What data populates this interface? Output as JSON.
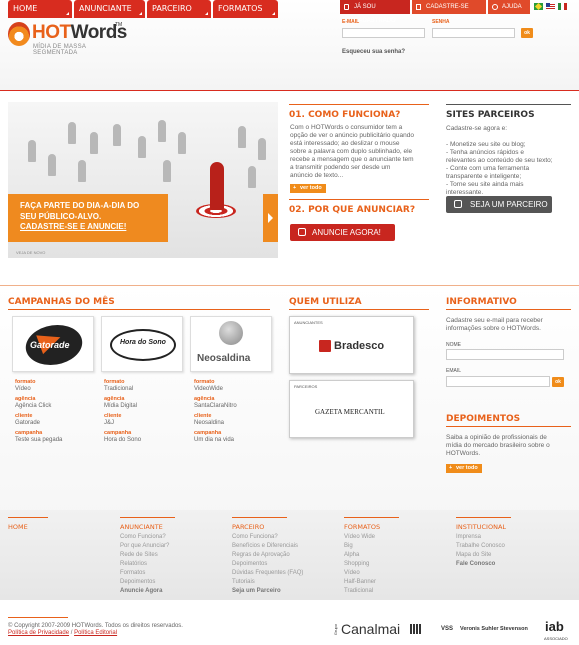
{
  "header": {
    "logo_text_hot": "HOT",
    "logo_text_words": "Words",
    "logo_tm": "TM",
    "logo_sub": "MÍDIA DE MASSA SEGMENTADA",
    "top_tabs": [
      "JÁ SOU CADASTRADO",
      "CADASTRE-SE",
      "AJUDA"
    ],
    "email_label": "E-MAIL",
    "password_label": "SENHA",
    "ok_label": "ok",
    "forgot": "Esqueceu sua senha?",
    "nav": [
      "HOME",
      "ANUNCIANTE",
      "PARCEIRO",
      "FORMATOS"
    ]
  },
  "hero": {
    "banner_line1": "FAÇA PARTE DO DIA-A-DIA DO",
    "banner_line2": "SEU PÚBLICO-ALVO.",
    "banner_link": "CADASTRE-SE E ANUNCIE!",
    "footer_text": "VEJA DE NOVO"
  },
  "how": {
    "title": "01. COMO FUNCIONA?",
    "lines": [
      "Com o HOTWords o consumidor tem a",
      "opção de ver o anúncio publicitário quando",
      "está interessado; ao deslizar o mouse",
      "sobre a palavra com duplo sublinhado, ele",
      "recebe a mensagem que o anunciante tem",
      "a transmitir podendo ser desde um",
      "anúncio de texto..."
    ],
    "ver_todo": "ver todo",
    "why_title": "02. POR QUE ANUNCIAR?",
    "cta": "ANUNCIE AGORA!"
  },
  "sites": {
    "title": "SITES PARCEIROS",
    "intro": "Cadastre-se agora e:",
    "lines": [
      "- Monetize seu site ou blog;",
      "- Tenha anúncios rápidos e",
      "relevantes ao conteúdo de seu texto;",
      "- Conte com uma ferramenta",
      "transparente e inteligente;",
      "- Torne seu site ainda mais",
      "interessante."
    ],
    "cta": "SEJA UM PARCEIRO"
  },
  "campaigns": {
    "title": "CAMPANHAS DO MÊS",
    "logos": [
      "Gatorade",
      "Hora do Sono",
      "Neosaldina"
    ],
    "labels": [
      "formato",
      "agência",
      "cliente",
      "campanha"
    ],
    "items": [
      {
        "formato": "Vídeo",
        "agencia": "Agência Click",
        "cliente": "Gatorade",
        "campanha": "Teste sua pegada"
      },
      {
        "formato": "Tradicional",
        "agencia": "Mídia Digital",
        "cliente": "J&J",
        "campanha": "Hora do Sono"
      },
      {
        "formato": "VideoWide",
        "agencia": "SantaClaraNitro",
        "cliente": "Neosaldina",
        "campanha": "Um dia na vida"
      }
    ]
  },
  "who": {
    "title": "QUEM UTILIZA",
    "advertisers_label": "ANUNCIANTES",
    "advertiser": "Bradesco",
    "partners_label": "PARCEIROS",
    "partner": "GAZETA MERCANTIL"
  },
  "info": {
    "title": "INFORMATIVO",
    "text": [
      "Cadastre seu e-mail para receber",
      "informações sobre o HOTWords."
    ],
    "name_label": "NOME",
    "email_label": "EMAIL",
    "ok_label": "ok"
  },
  "testimonials": {
    "title": "DEPOIMENTOS",
    "text": [
      "Saiba a opinião de profissionais de",
      "mídia do mercado brasileiro sobre o",
      "HOTWords."
    ],
    "ver_todo": "ver todo"
  },
  "footer": {
    "columns": [
      {
        "title": "HOME",
        "links": []
      },
      {
        "title": "ANUNCIANTE",
        "links": [
          "Como Funciona?",
          "Por que Anunciar?",
          "Rede de Sites",
          "Relatórios",
          "Formatos",
          "Depoimentos"
        ],
        "bold": "Anuncie Agora"
      },
      {
        "title": "PARCEIRO",
        "links": [
          "Como Funciona?",
          "Benefícios e Diferenciais",
          "Regras de Aprovação",
          "Depoimentos",
          "Dúvidas Frequentes (FAQ)",
          "Tutoriais"
        ],
        "bold": "Seja um Parceiro"
      },
      {
        "title": "FORMATOS",
        "links": [
          "Vídeo Wide",
          "Big",
          "Alpha",
          "Shopping",
          "Vídeo",
          "Half-Banner",
          "Tradicional"
        ],
        "bold": ""
      },
      {
        "title": "INSTITUCIONAL",
        "links": [
          "Imprensa",
          "Trabalhe Conosco",
          "Mapa do Site"
        ],
        "bold": "Fale Conosco"
      }
    ],
    "copyright": "© Copyright 2007-2009 HOTWords. Todos os direitos reservados.",
    "privacy": "Política de Privacidade",
    "separator": "/",
    "editorial": "Política Editorial",
    "canal_small": "Grupo",
    "canal": "Canalmai",
    "vss": "VSS",
    "veronis": "Veronis Suhler Stevenson",
    "iab": "iab",
    "iab_sub": "ASSOCIADO"
  }
}
